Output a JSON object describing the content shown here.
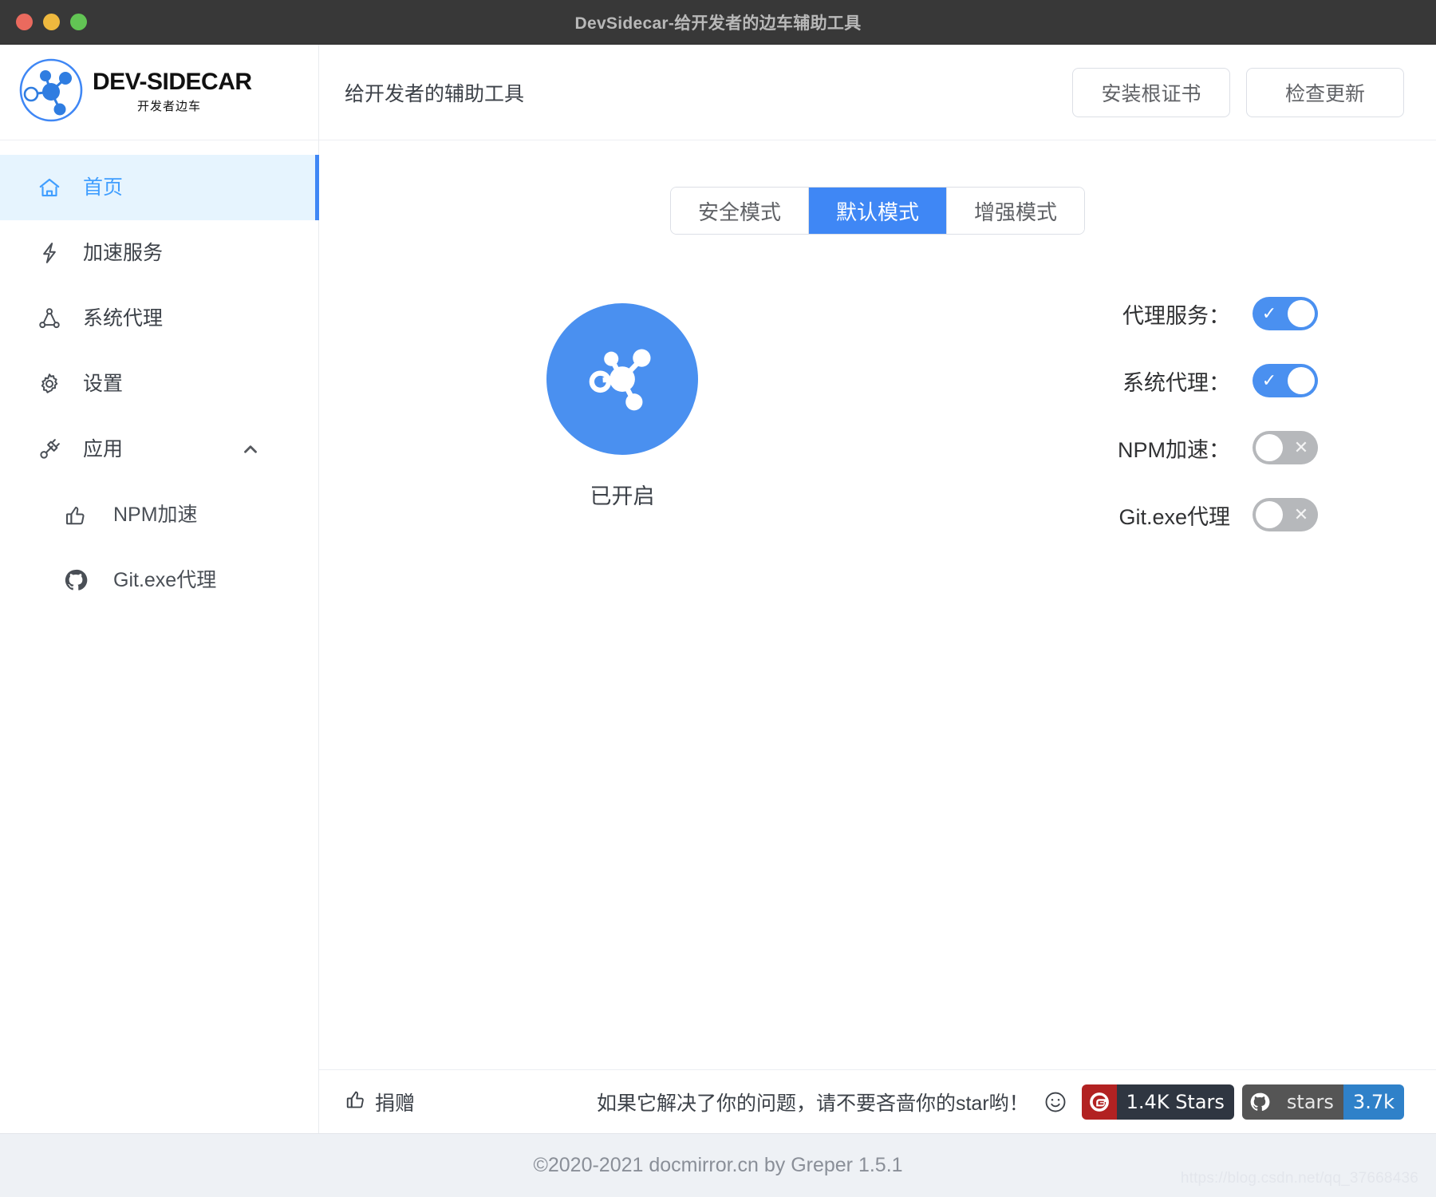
{
  "window": {
    "title": "DevSidecar-给开发者的边车辅助工具",
    "traffic_lights": {
      "close": "close-button",
      "minimize": "minimize-button",
      "maximize": "maximize-button"
    }
  },
  "brand": {
    "name": "DEV-SIDECAR",
    "subtitle": "开发者边车",
    "accent_color": "#3f87f5"
  },
  "sidebar": {
    "items": [
      {
        "label": "首页",
        "icon": "home-icon",
        "active": true
      },
      {
        "label": "加速服务",
        "icon": "lightning-icon",
        "active": false
      },
      {
        "label": "系统代理",
        "icon": "network-icon",
        "active": false
      },
      {
        "label": "设置",
        "icon": "gear-icon",
        "active": false
      },
      {
        "label": "应用",
        "icon": "plug-icon",
        "active": false,
        "expanded": true,
        "arrow": "chevron-up-icon"
      }
    ],
    "sub_items": [
      {
        "label": "NPM加速",
        "icon": "thumbs-up-icon"
      },
      {
        "label": "Git.exe代理",
        "icon": "github-icon"
      }
    ]
  },
  "topbar": {
    "title": "给开发者的辅助工具",
    "buttons": [
      {
        "label": "安装根证书",
        "name": "install-root-certificate-button"
      },
      {
        "label": "检查更新",
        "name": "check-update-button"
      }
    ]
  },
  "modes": {
    "tabs": [
      {
        "label": "安全模式",
        "active": false
      },
      {
        "label": "默认模式",
        "active": true
      },
      {
        "label": "增强模式",
        "active": false
      }
    ],
    "active_color": "#3f87f5"
  },
  "status": {
    "label": "已开启",
    "icon": "molecule-icon",
    "circle_color": "#4a90f0",
    "enabled": true
  },
  "switches": [
    {
      "label": "代理服务：",
      "name": "proxy-service-toggle",
      "on": true,
      "mark": "✓"
    },
    {
      "label": "系统代理：",
      "name": "system-proxy-toggle",
      "on": true,
      "mark": "✓"
    },
    {
      "label": "NPM加速：",
      "name": "npm-accelerate-toggle",
      "on": false,
      "mark": "✕"
    },
    {
      "label": "Git.exe代理",
      "name": "git-exe-proxy-toggle",
      "on": false,
      "mark": "✕"
    }
  ],
  "footer": {
    "donate_label": "捐赠",
    "donate_icon": "thumbs-up-icon",
    "star_message": "如果它解决了你的问题，请不要吝啬你的star哟！",
    "smiley_icon": "smiley-icon",
    "badges": [
      {
        "name": "gitee-stars-badge",
        "icon": "gitee-icon",
        "icon_bg": "#b22222",
        "text": "1.4K Stars",
        "text_bg": "#2f3641"
      },
      {
        "name": "github-stars-badge",
        "icon": "github-icon",
        "icon_bg": "#555555",
        "text": "stars",
        "text_bg": "#555555",
        "value": "3.7k",
        "value_bg": "#2f81c9"
      }
    ]
  },
  "copyright": {
    "text": "©2020-2021 docmirror.cn by Greper 1.5.1",
    "watermark": "https://blog.csdn.net/qq_37668436"
  }
}
